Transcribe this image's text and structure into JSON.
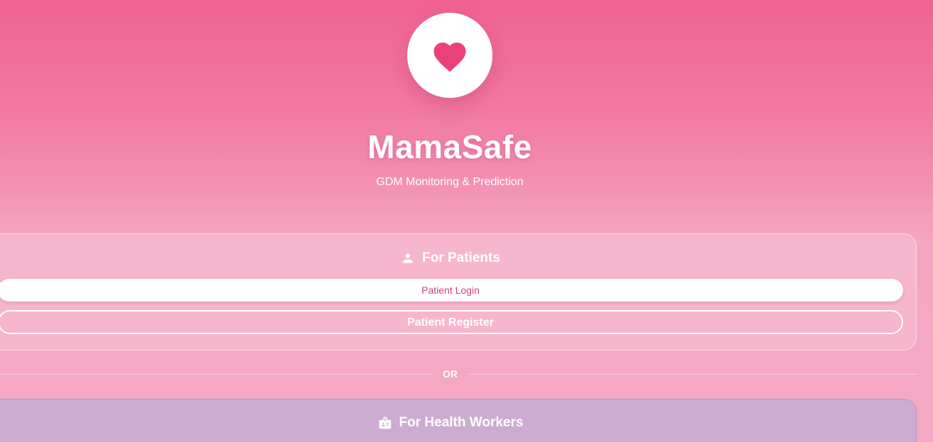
{
  "app": {
    "title": "MamaSafe",
    "subtitle": "GDM Monitoring & Prediction"
  },
  "patients": {
    "heading": "For Patients",
    "icon": "person-icon",
    "login_label": "Patient Login",
    "register_label": "Patient Register"
  },
  "divider": {
    "label": "OR"
  },
  "workers": {
    "heading": "For Health Workers",
    "icon": "id-badge-icon"
  },
  "colors": {
    "brand": "#ec407a",
    "gradient_top": "#f06292",
    "gradient_bottom": "#f5a9c4",
    "workers_card": "#cdacd2",
    "login_text": "#d63c7e"
  }
}
